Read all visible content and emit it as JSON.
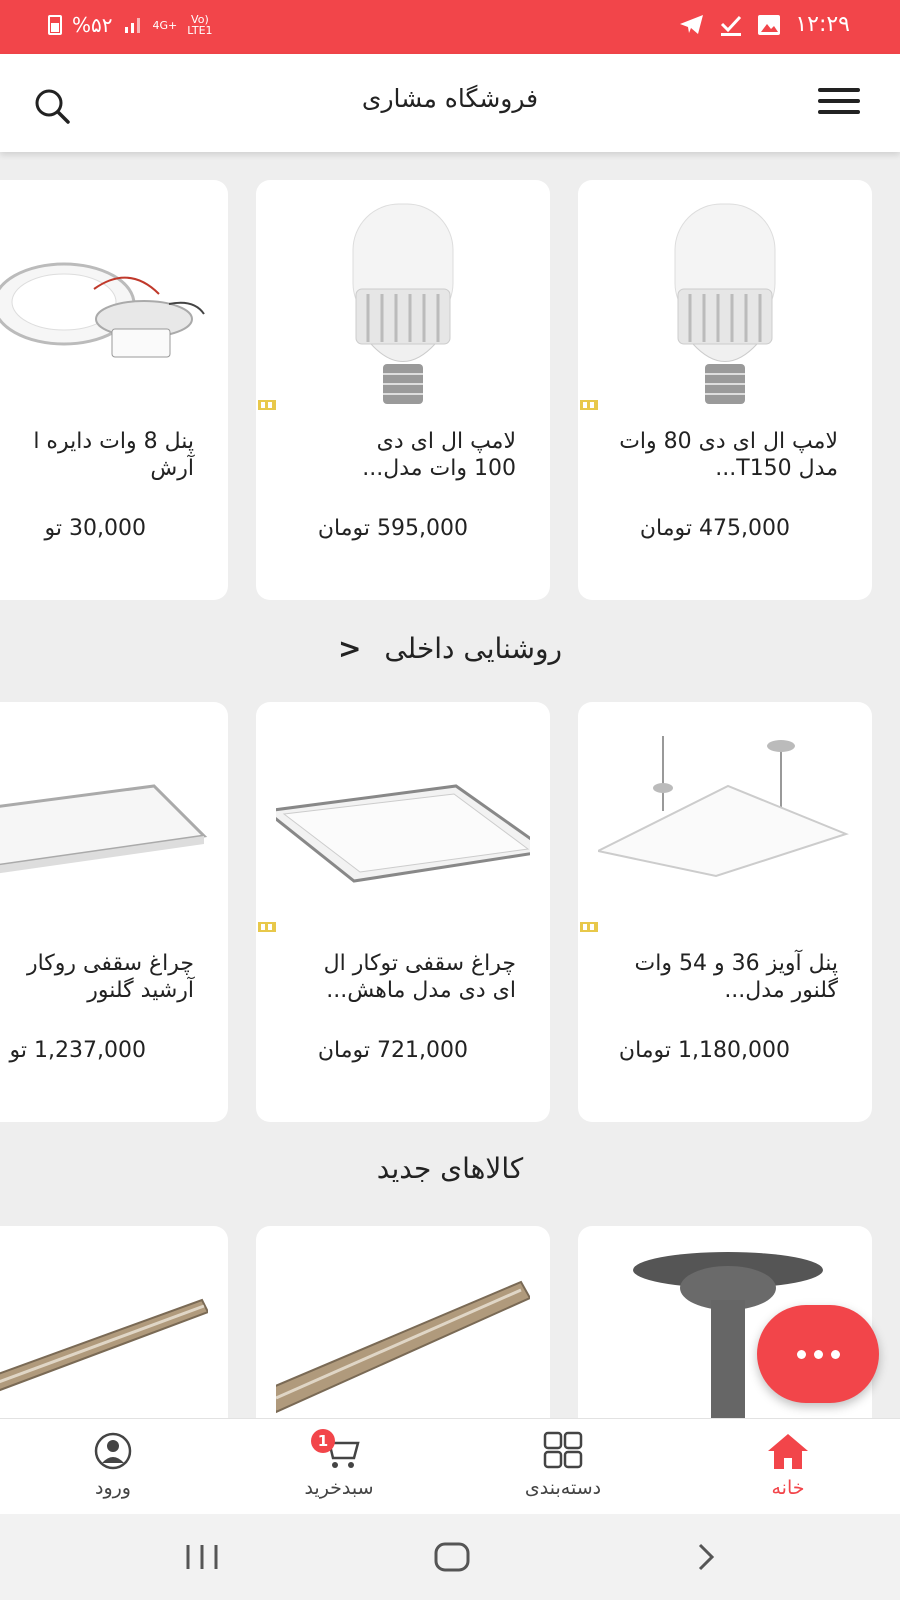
{
  "status_bar": {
    "time": "۱۲:۲۹",
    "battery": "%۵۲",
    "network": "4G+",
    "volte_top": "Vo)",
    "volte_bottom": "LTE1"
  },
  "header": {
    "title": "فروشگاه مشاری"
  },
  "row1_products": [
    {
      "name": "لامپ ال ای دی 80 وات مدل T150...",
      "price": "475,000 تومان"
    },
    {
      "name": "لامپ ال ای دی\n100 وات مدل...",
      "price": "595,000 تومان"
    },
    {
      "name": "پنل 8 وات دایره ا\nآرش",
      "price": "30,000 تو"
    }
  ],
  "section_indoor": {
    "title": "روشنایی داخلی",
    "arrow": "<"
  },
  "row2_products": [
    {
      "name": "پنل آویز 36 و 54 وات گلنور مدل...",
      "price": "1,180,000 تومان"
    },
    {
      "name": "چراغ سقفی توکار ال\nای دی مدل ماهش...",
      "price": "721,000 تومان"
    },
    {
      "name": "چراغ سقفی روکار\nآرشید گلنور",
      "price": "1,237,000 تو"
    }
  ],
  "section_new": {
    "title": "کالاهای جدید"
  },
  "bottom_nav": {
    "home": "خانه",
    "categories": "دسته‌بندی",
    "cart": "سبدخرید",
    "cart_count": "1",
    "login": "ورود"
  },
  "colors": {
    "accent": "#f2454a",
    "background": "#eeeeee",
    "card": "#ffffff",
    "text": "#222222"
  },
  "icons": [
    "search-icon",
    "menu-icon",
    "more-dots-icon",
    "home-icon",
    "grid-icon",
    "cart-icon",
    "user-icon",
    "chevron-left-icon"
  ]
}
